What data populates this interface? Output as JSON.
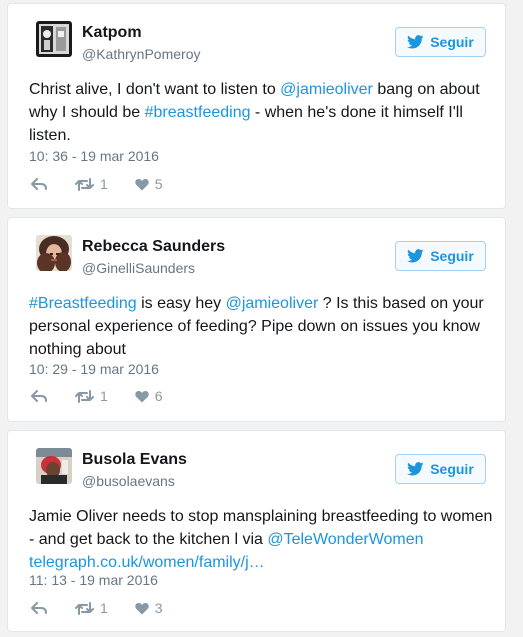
{
  "tweets": [
    {
      "name": "Katpom",
      "handle": "@KathrynPomeroy",
      "follow_label": "Seguir",
      "text": [
        {
          "t": "Christ alive, I don't want to listen to "
        },
        {
          "t": "@jamieoliver",
          "link": true
        },
        {
          "t": " bang on about why I should be "
        },
        {
          "t": "#breastfeeding",
          "link": true
        },
        {
          "t": " - when he's done it himself I'll listen."
        }
      ],
      "time": "10: 36 - 19 mar 2016",
      "retweets": "1",
      "likes": "5"
    },
    {
      "name": "Rebecca Saunders",
      "handle": "@GinelliSaunders",
      "follow_label": "Seguir",
      "text": [
        {
          "t": "#Breastfeeding",
          "link": true
        },
        {
          "t": " is easy hey "
        },
        {
          "t": "@jamieoliver",
          "link": true
        },
        {
          "t": " ? Is this based on your personal experience of feeding? Pipe down on issues you know nothing about"
        }
      ],
      "time": "10: 29 - 19 mar 2016",
      "retweets": "1",
      "likes": "6"
    },
    {
      "name": "Busola Evans",
      "handle": "@busolaevans",
      "follow_label": "Seguir",
      "text": [
        {
          "t": "Jamie Oliver needs to stop mansplaining breastfeeding to women - and get back to the kitchen l via "
        },
        {
          "t": "@TeleWonderWomen",
          "link": true
        },
        {
          "t": " "
        },
        {
          "t": "telegraph.co.uk/women/family/j…",
          "link": true
        }
      ],
      "time": "11: 13 - 19 mar 2016",
      "retweets": "1",
      "likes": "3"
    }
  ],
  "colors": {
    "link": "#1b95e0",
    "muted": "#657786",
    "action": "#8899a6",
    "background": "#f2f2f2",
    "card_border": "#e1e8ed"
  },
  "icons": [
    "bird-icon",
    "reply-icon",
    "retweet-icon",
    "heart-icon"
  ]
}
